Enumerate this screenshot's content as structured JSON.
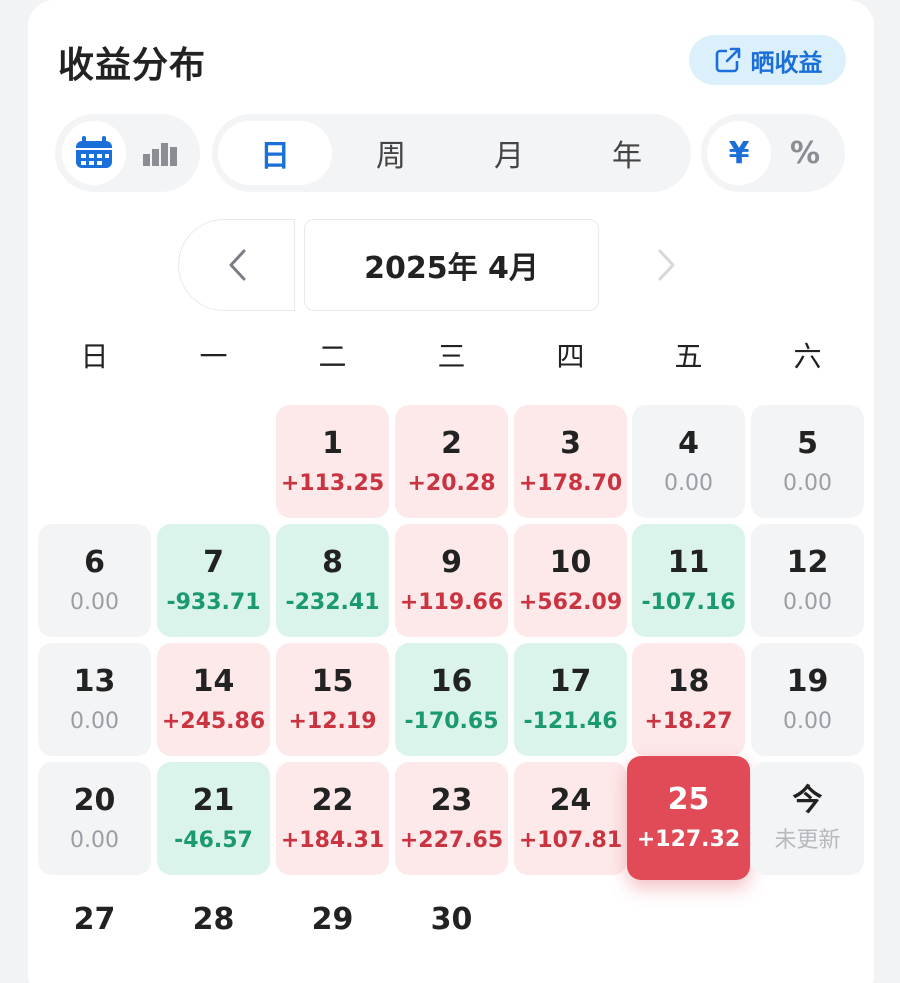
{
  "header": {
    "title": "收益分布",
    "share_label": "晒收益"
  },
  "view_toggle": {
    "calendar_icon": "calendar-icon",
    "chart_icon": "bar-chart-icon",
    "active": "calendar"
  },
  "period_tabs": [
    {
      "label": "日",
      "active": true
    },
    {
      "label": "周",
      "active": false
    },
    {
      "label": "月",
      "active": false
    },
    {
      "label": "年",
      "active": false
    }
  ],
  "unit_toggle": [
    {
      "label": "¥",
      "active": true
    },
    {
      "label": "%",
      "active": false
    }
  ],
  "month_nav": {
    "current": "2025年 4月",
    "prev_icon": "chevron-left-icon",
    "next_icon": "chevron-right-icon"
  },
  "weekdays": [
    "日",
    "一",
    "二",
    "三",
    "四",
    "五",
    "六"
  ],
  "days": [
    {
      "day": "1",
      "value": "+113.25",
      "status": "up"
    },
    {
      "day": "2",
      "value": "+20.28",
      "status": "up"
    },
    {
      "day": "3",
      "value": "+178.70",
      "status": "up"
    },
    {
      "day": "4",
      "value": "0.00",
      "status": "zero"
    },
    {
      "day": "5",
      "value": "0.00",
      "status": "zero"
    },
    {
      "day": "6",
      "value": "0.00",
      "status": "zero"
    },
    {
      "day": "7",
      "value": "-933.71",
      "status": "down"
    },
    {
      "day": "8",
      "value": "-232.41",
      "status": "down"
    },
    {
      "day": "9",
      "value": "+119.66",
      "status": "up"
    },
    {
      "day": "10",
      "value": "+562.09",
      "status": "up"
    },
    {
      "day": "11",
      "value": "-107.16",
      "status": "down"
    },
    {
      "day": "12",
      "value": "0.00",
      "status": "zero"
    },
    {
      "day": "13",
      "value": "0.00",
      "status": "zero"
    },
    {
      "day": "14",
      "value": "+245.86",
      "status": "up"
    },
    {
      "day": "15",
      "value": "+12.19",
      "status": "up"
    },
    {
      "day": "16",
      "value": "-170.65",
      "status": "down"
    },
    {
      "day": "17",
      "value": "-121.46",
      "status": "down"
    },
    {
      "day": "18",
      "value": "+18.27",
      "status": "up"
    },
    {
      "day": "19",
      "value": "0.00",
      "status": "zero"
    },
    {
      "day": "20",
      "value": "0.00",
      "status": "zero"
    },
    {
      "day": "21",
      "value": "-46.57",
      "status": "down"
    },
    {
      "day": "22",
      "value": "+184.31",
      "status": "up"
    },
    {
      "day": "23",
      "value": "+227.65",
      "status": "up"
    },
    {
      "day": "24",
      "value": "+107.81",
      "status": "up"
    },
    {
      "day": "25",
      "value": "+127.32",
      "status": "selected"
    },
    {
      "day": "今",
      "value": "未更新",
      "status": "pending"
    },
    {
      "day": "27",
      "value": "",
      "status": "plain"
    },
    {
      "day": "28",
      "value": "",
      "status": "plain"
    },
    {
      "day": "29",
      "value": "",
      "status": "plain"
    },
    {
      "day": "30",
      "value": "",
      "status": "plain"
    }
  ],
  "colors": {
    "up": "#c93440",
    "down": "#1b9a6e",
    "selected": "#e04b57",
    "accent": "#1a6fd8"
  }
}
